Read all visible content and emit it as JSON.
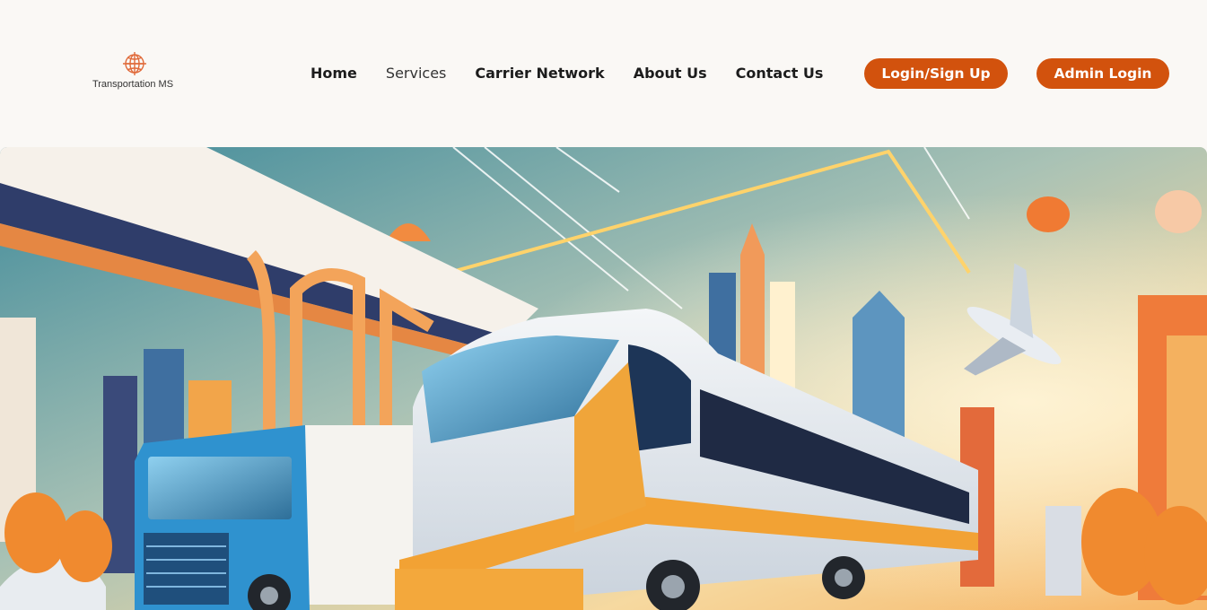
{
  "brand": {
    "name": "Transportation MS",
    "accent": "#d2520d",
    "logo_icon": "globe-icon"
  },
  "nav": {
    "items": [
      {
        "label": "Home"
      },
      {
        "label": "Services"
      },
      {
        "label": "Carrier Network"
      },
      {
        "label": "About Us"
      },
      {
        "label": "Contact Us"
      }
    ]
  },
  "actions": {
    "login_label": "Login/Sign Up",
    "admin_label": "Admin Login"
  },
  "hero": {
    "image": "transport-illustration"
  }
}
